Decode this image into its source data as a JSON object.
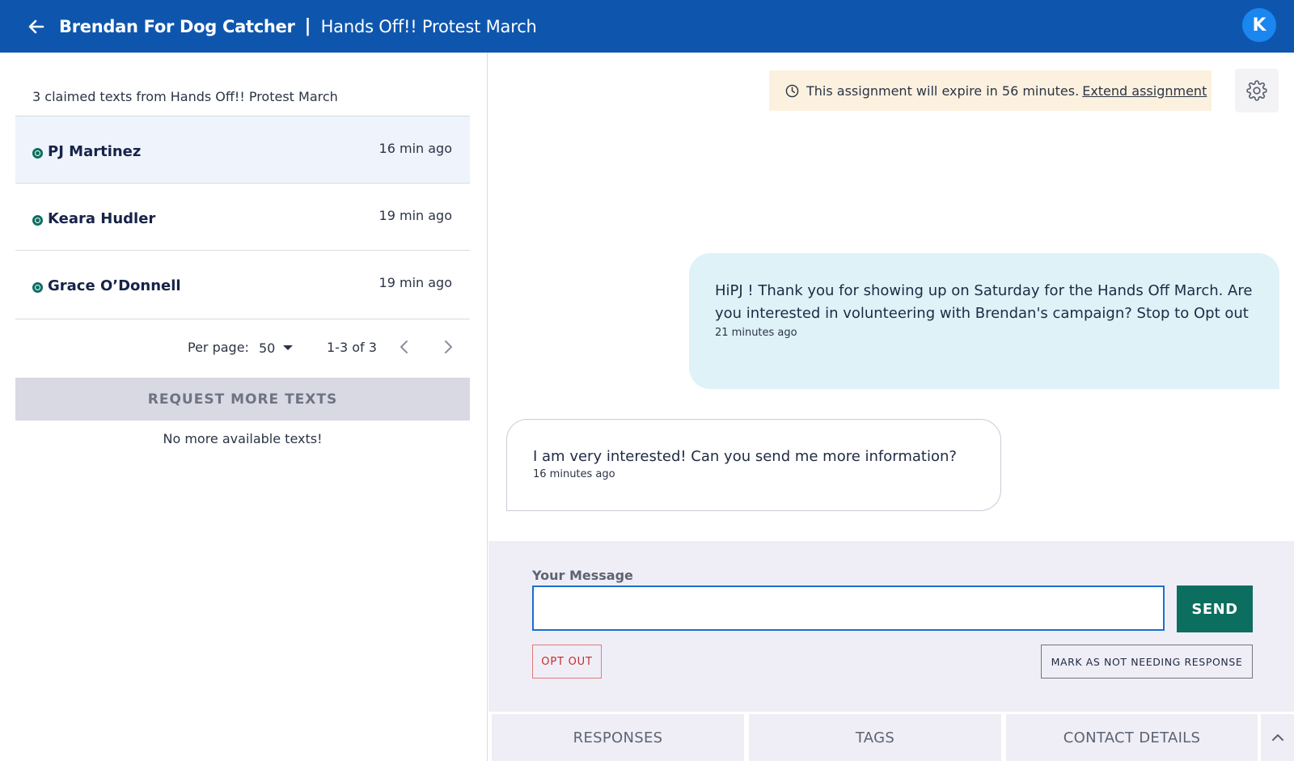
{
  "header": {
    "org_name": "Brendan For Dog Catcher",
    "separator": "|",
    "campaign_name": "Hands Off!! Protest March",
    "avatar_initial": "K",
    "brand_color": "#0e56ad"
  },
  "sidebar": {
    "claimed_text": "3 claimed texts from Hands Off!! Protest March",
    "conversations": [
      {
        "name": "PJ Martinez",
        "time": "16 min ago"
      },
      {
        "name": "Keara Hudler",
        "time": "19 min ago"
      },
      {
        "name": "Grace O’Donnell",
        "time": "19 min ago"
      }
    ],
    "pagination": {
      "per_page_label": "Per page:",
      "per_page_value": "50",
      "range": "1-3 of 3"
    },
    "request_button": "REQUEST MORE TEXTS",
    "no_more": "No more available texts!"
  },
  "conversation": {
    "expire_notice": "This assignment will expire in 56 minutes.",
    "extend_link": "Extend assignment",
    "messages": [
      {
        "direction": "outgoing",
        "text": "HiPJ ! Thank you for showing up on Saturday for the Hands Off March. Are you interested in volunteering with Brendan's campaign? Stop to Opt out",
        "time": "21 minutes ago"
      },
      {
        "direction": "incoming",
        "text": "I am very interested! Can you send me more information?",
        "time": "16 minutes ago"
      }
    ]
  },
  "composer": {
    "label": "Your Message",
    "placeholder": "",
    "value": "",
    "send_label": "SEND",
    "opt_out_label": "OPT OUT",
    "mark_label": "MARK AS NOT NEEDING RESPONSE",
    "accent_color": "#0b6e5f"
  },
  "tabs": [
    "RESPONSES",
    "TAGS",
    "CONTACT DETAILS"
  ]
}
